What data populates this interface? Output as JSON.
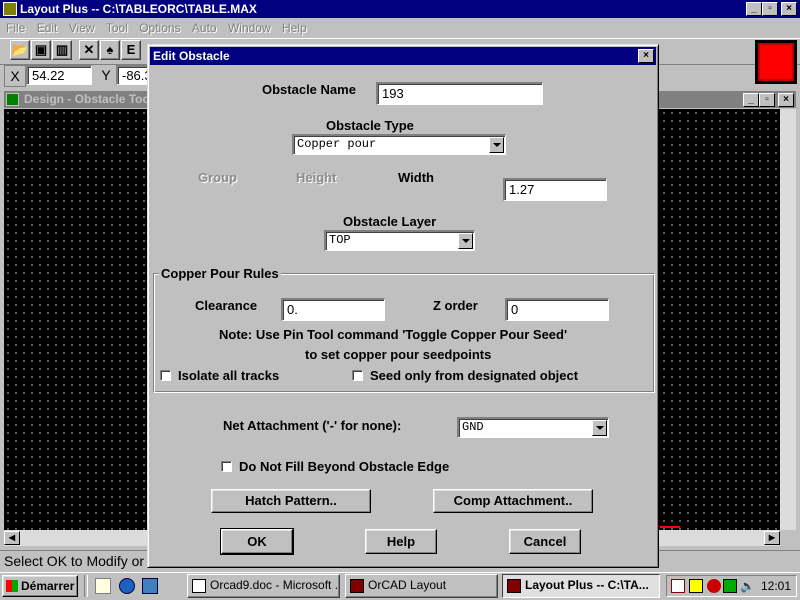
{
  "app": {
    "title": "Layout Plus -- C:\\TABLEORC\\TABLE.MAX",
    "menu": [
      "File",
      "Edit",
      "View",
      "Tool",
      "Options",
      "Auto",
      "Window",
      "Help"
    ],
    "coords": {
      "x_label": "X",
      "x_value": "54.22",
      "y_label": "Y",
      "y_value": "-86.3"
    }
  },
  "design_window": {
    "title": "Design - Obstacle Tool"
  },
  "status_bar": {
    "text": "Select OK to Modify or Cancel"
  },
  "dialog": {
    "title": "Edit Obstacle",
    "obstacle_name_label": "Obstacle Name",
    "obstacle_name_value": "193",
    "obstacle_type_label": "Obstacle Type",
    "obstacle_type_value": "Copper pour",
    "group_label": "Group",
    "height_label": "Height",
    "width_label": "Width",
    "width_value": "1.27",
    "obstacle_layer_label": "Obstacle Layer",
    "obstacle_layer_value": "TOP",
    "copper_rules": {
      "legend": "Copper Pour Rules",
      "clearance_label": "Clearance",
      "clearance_value": "0.",
      "zorder_label": "Z order",
      "zorder_value": "0",
      "note_line1": "Note: Use Pin Tool command 'Toggle Copper Pour Seed'",
      "note_line2": "to set copper pour seedpoints",
      "isolate_label": "Isolate all tracks",
      "seed_label": "Seed only from designated object"
    },
    "net_attachment_label": "Net Attachment ('-' for none):",
    "net_attachment_value": "GND",
    "do_not_fill_label": "Do Not Fill Beyond Obstacle Edge",
    "hatch_button": "Hatch Pattern..",
    "comp_button": "Comp Attachment..",
    "ok_button": "OK",
    "help_button": "Help",
    "cancel_button": "Cancel"
  },
  "taskbar": {
    "start_label": "Démarrer",
    "items": [
      "Orcad9.doc - Microsoft ...",
      "OrCAD Layout",
      "Layout Plus -- C:\\TA..."
    ],
    "clock": "12:01"
  },
  "colors": {
    "title_blue": "#000080",
    "face_grey": "#c0c0c0",
    "canvas_black": "#000000",
    "swatch_red": "#ff0000"
  }
}
